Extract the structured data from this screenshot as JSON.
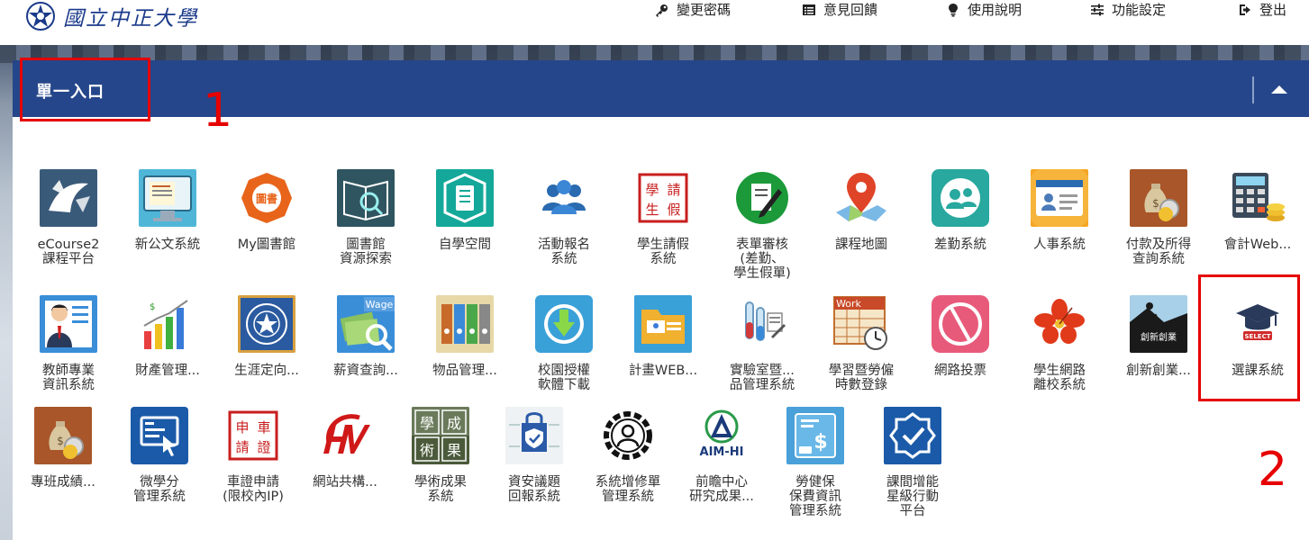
{
  "header": {
    "logo_text": "國立中正大學",
    "nav": [
      {
        "label": "變更密碼",
        "icon": "key-icon"
      },
      {
        "label": "意見回饋",
        "icon": "list-icon"
      },
      {
        "label": "使用說明",
        "icon": "lightbulb-icon"
      },
      {
        "label": "功能設定",
        "icon": "sliders-icon"
      },
      {
        "label": "登出",
        "icon": "logout-icon"
      }
    ]
  },
  "panel": {
    "title": "單一入口"
  },
  "annotations": {
    "mark1": "1",
    "mark2": "2"
  },
  "apps": [
    {
      "label": "eCourse2\n課程平台",
      "icon": "ecourse-icon"
    },
    {
      "label": "新公文系統",
      "icon": "document-system-icon"
    },
    {
      "label": "My圖書館",
      "icon": "my-library-icon"
    },
    {
      "label": "圖書館\n資源探索",
      "icon": "library-search-icon"
    },
    {
      "label": "自學空間",
      "icon": "self-study-icon"
    },
    {
      "label": "活動報名\n系統",
      "icon": "people-icon"
    },
    {
      "label": "學生請假\n系統",
      "icon": "leave-stamp-icon"
    },
    {
      "label": "表單審核\n(差勤、\n學生假單)",
      "icon": "form-review-icon"
    },
    {
      "label": "課程地圖",
      "icon": "map-pin-icon"
    },
    {
      "label": "差勤系統",
      "icon": "attendance-icon"
    },
    {
      "label": "人事系統",
      "icon": "id-card-icon"
    },
    {
      "label": "付款及所得\n查詢系統",
      "icon": "money-bag-icon"
    },
    {
      "label": "會計Web...",
      "icon": "calculator-icon"
    },
    {
      "label": "教師專業\n資訊系統",
      "icon": "teacher-icon"
    },
    {
      "label": "財產管理...",
      "icon": "bar-chart-icon"
    },
    {
      "label": "生涯定向...",
      "icon": "career-seal-icon"
    },
    {
      "label": "薪資查詢...",
      "icon": "wage-icon"
    },
    {
      "label": "物品管理...",
      "icon": "binders-icon"
    },
    {
      "label": "校園授權\n軟體下載",
      "icon": "download-icon"
    },
    {
      "label": "計畫WEB...",
      "icon": "project-folder-icon"
    },
    {
      "label": "實驗室暨...\n品管理系統",
      "icon": "lab-flask-icon"
    },
    {
      "label": "學習暨勞僱\n時數登錄",
      "icon": "work-calendar-icon"
    },
    {
      "label": "網路投票",
      "icon": "vote-icon"
    },
    {
      "label": "學生網路\n離校系統",
      "icon": "flower-icon"
    },
    {
      "label": "創新創業...",
      "icon": "startup-icon"
    },
    {
      "label": "選課系統",
      "icon": "course-select-icon"
    },
    {
      "label": "專班成績...",
      "icon": "money-bag-small-icon"
    },
    {
      "label": "微學分\n管理系統",
      "icon": "micro-credit-icon"
    },
    {
      "label": "車證申請\n(限校內IP)",
      "icon": "car-permit-stamp-icon"
    },
    {
      "label": "網站共構...",
      "icon": "hv-logo-icon"
    },
    {
      "label": "學術成果\n系統",
      "icon": "academic-results-icon"
    },
    {
      "label": "資安議題\n回報系統",
      "icon": "security-icon"
    },
    {
      "label": "系統增修單\n管理系統",
      "icon": "gear-user-icon"
    },
    {
      "label": "前瞻中心\n研究成果...",
      "icon": "aim-hi-icon"
    },
    {
      "label": "勞健保\n保費資訊\n管理系統",
      "icon": "insurance-icon"
    },
    {
      "label": "課間增能\n星級行動\n平台",
      "icon": "check-badge-icon"
    }
  ]
}
